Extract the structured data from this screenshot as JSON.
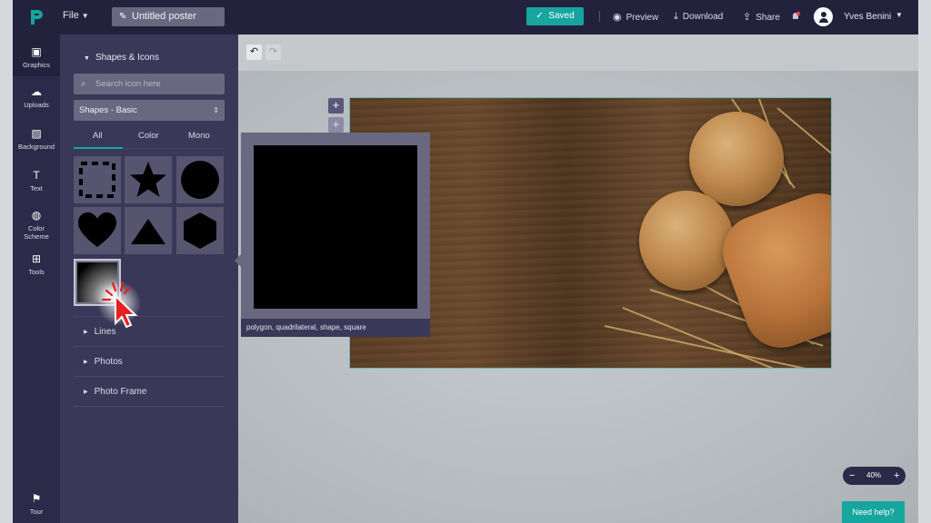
{
  "app": {
    "file_menu": "File",
    "poster_title": "Untitled poster",
    "saved_label": "Saved",
    "preview_label": "Preview",
    "download_label": "Download",
    "share_label": "Share",
    "user_name": "Yves Benini",
    "accent_color": "#17a5a0"
  },
  "leftnav": {
    "items": [
      {
        "label": "Graphics",
        "icon": "image-icon"
      },
      {
        "label": "Uploads",
        "icon": "cloud-upload-icon"
      },
      {
        "label": "Background",
        "icon": "background-pattern-icon"
      },
      {
        "label": "Text",
        "icon": "text-icon"
      },
      {
        "label": "Color Scheme",
        "icon": "palette-icon"
      },
      {
        "label": "Tools",
        "icon": "toolbox-icon"
      }
    ],
    "tour_label": "Tour"
  },
  "panel": {
    "section_title": "Shapes & Icons",
    "search_placeholder": "Search icon here",
    "category_select": "Shapes - Basic",
    "tabs": [
      "All",
      "Color",
      "Mono"
    ],
    "active_tab": "All",
    "shapes": [
      "dashed-square",
      "star",
      "circle",
      "heart",
      "triangle",
      "hexagon",
      "gradient-square"
    ],
    "categories": [
      "Lines",
      "Photos",
      "Photo Frame"
    ]
  },
  "preview": {
    "caption": "polygon, quadrilateral, shape, square"
  },
  "zoom": {
    "value": "40%"
  },
  "help": {
    "label": "Need help?"
  }
}
